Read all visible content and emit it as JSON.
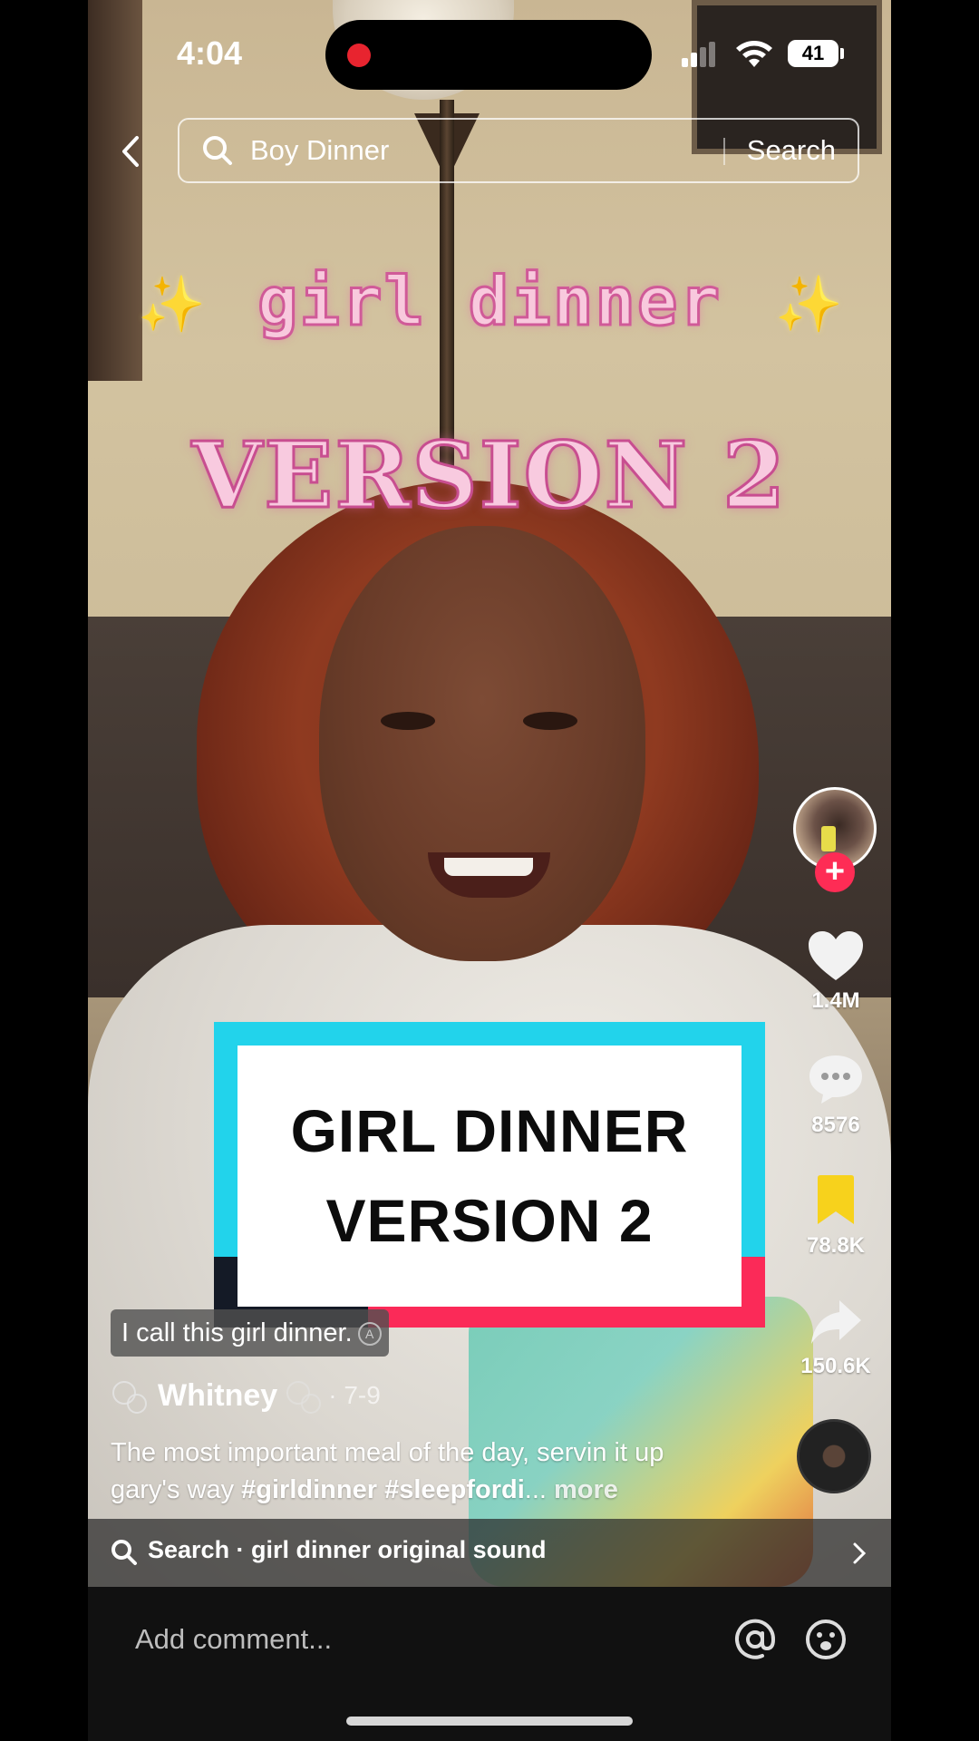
{
  "status_bar": {
    "time": "4:04",
    "battery": "41"
  },
  "search": {
    "query": "Boy Dinner",
    "button": "Search"
  },
  "overlay": {
    "title_line1": "girl dinner",
    "title_line2": "VERSION 2",
    "card_line1": "GIRL DINNER",
    "card_line2": "VERSION 2",
    "sparkle": "✨"
  },
  "rail": {
    "likes": "1.4M",
    "comments": "8576",
    "saves": "78.8K",
    "shares": "150.6K",
    "follow": "+"
  },
  "post": {
    "caption_chip": "I call this girl dinner.",
    "author": "Whitney",
    "date": "· 7-9",
    "description_text": "The most important meal of the day, servin it up gary's way ",
    "hashtag1": "#girldinner",
    "hashtag2": "#sleepfordi",
    "ellipsis": "...",
    "more": "more"
  },
  "sound_search": {
    "label": "Search · girl dinner original sound"
  },
  "comment": {
    "placeholder": "Add comment..."
  },
  "colors": {
    "accent": "#fe2c55",
    "card_cyan": "#22d3eb",
    "save_yellow": "#f7d21c"
  }
}
